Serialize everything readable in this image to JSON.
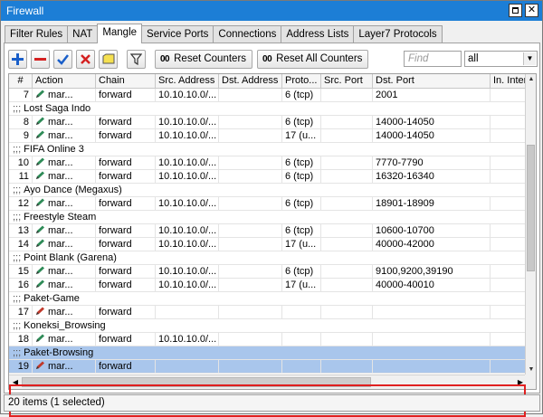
{
  "window": {
    "title": "Firewall"
  },
  "tabs": [
    {
      "label": "Filter Rules",
      "active": false
    },
    {
      "label": "NAT",
      "active": false
    },
    {
      "label": "Mangle",
      "active": true
    },
    {
      "label": "Service Ports",
      "active": false
    },
    {
      "label": "Connections",
      "active": false
    },
    {
      "label": "Address Lists",
      "active": false
    },
    {
      "label": "Layer7 Protocols",
      "active": false
    }
  ],
  "toolbar": {
    "add_icon": "plus-icon",
    "remove_icon": "minus-icon",
    "enable_icon": "check-icon",
    "disable_icon": "x-icon",
    "comment_icon": "note-icon",
    "filter_icon": "funnel-icon",
    "reset_counters_label": "Reset Counters",
    "reset_all_counters_label": "Reset All Counters",
    "counter_icon_text": "00",
    "find_placeholder": "Find",
    "filter_select_value": "all"
  },
  "colors": {
    "titlebar": "#1c7ed6",
    "selected_row": "#a9c6ec",
    "highlight_border": "#e02020",
    "add_icon": "#1a5fc9",
    "remove_icon": "#d42020",
    "pencil_green": "#2e8b57",
    "pencil_red": "#c0392b"
  },
  "table": {
    "columns": [
      "#",
      "Action",
      "Chain",
      "Src. Address",
      "Dst. Address",
      "Proto...",
      "Src. Port",
      "Dst. Port",
      "In. Inter..."
    ],
    "rows": [
      {
        "type": "rule",
        "num": "7",
        "action": "mar...",
        "chain": "forward",
        "src": "10.10.10.0/...",
        "dst": "",
        "proto": "6 (tcp)",
        "sport": "",
        "dport": "2001",
        "pencil": "green"
      },
      {
        "type": "comment",
        "text": "Lost Saga Indo"
      },
      {
        "type": "rule",
        "num": "8",
        "action": "mar...",
        "chain": "forward",
        "src": "10.10.10.0/...",
        "dst": "",
        "proto": "6 (tcp)",
        "sport": "",
        "dport": "14000-14050",
        "pencil": "green"
      },
      {
        "type": "rule",
        "num": "9",
        "action": "mar...",
        "chain": "forward",
        "src": "10.10.10.0/...",
        "dst": "",
        "proto": "17 (u...",
        "sport": "",
        "dport": "14000-14050",
        "pencil": "green"
      },
      {
        "type": "comment",
        "text": "FIFA Online 3"
      },
      {
        "type": "rule",
        "num": "10",
        "action": "mar...",
        "chain": "forward",
        "src": "10.10.10.0/...",
        "dst": "",
        "proto": "6 (tcp)",
        "sport": "",
        "dport": "7770-7790",
        "pencil": "green"
      },
      {
        "type": "rule",
        "num": "11",
        "action": "mar...",
        "chain": "forward",
        "src": "10.10.10.0/...",
        "dst": "",
        "proto": "6 (tcp)",
        "sport": "",
        "dport": "16320-16340",
        "pencil": "green"
      },
      {
        "type": "comment",
        "text": "Ayo Dance (Megaxus)"
      },
      {
        "type": "rule",
        "num": "12",
        "action": "mar...",
        "chain": "forward",
        "src": "10.10.10.0/...",
        "dst": "",
        "proto": "6 (tcp)",
        "sport": "",
        "dport": "18901-18909",
        "pencil": "green"
      },
      {
        "type": "comment",
        "text": "Freestyle Steam"
      },
      {
        "type": "rule",
        "num": "13",
        "action": "mar...",
        "chain": "forward",
        "src": "10.10.10.0/...",
        "dst": "",
        "proto": "6 (tcp)",
        "sport": "",
        "dport": "10600-10700",
        "pencil": "green"
      },
      {
        "type": "rule",
        "num": "14",
        "action": "mar...",
        "chain": "forward",
        "src": "10.10.10.0/...",
        "dst": "",
        "proto": "17 (u...",
        "sport": "",
        "dport": "40000-42000",
        "pencil": "green"
      },
      {
        "type": "comment",
        "text": "Point Blank (Garena)"
      },
      {
        "type": "rule",
        "num": "15",
        "action": "mar...",
        "chain": "forward",
        "src": "10.10.10.0/...",
        "dst": "",
        "proto": "6 (tcp)",
        "sport": "",
        "dport": "9100,9200,39190",
        "pencil": "green"
      },
      {
        "type": "rule",
        "num": "16",
        "action": "mar...",
        "chain": "forward",
        "src": "10.10.10.0/...",
        "dst": "",
        "proto": "17 (u...",
        "sport": "",
        "dport": "40000-40010",
        "pencil": "green"
      },
      {
        "type": "comment",
        "text": "Paket-Game"
      },
      {
        "type": "rule",
        "num": "17",
        "action": "mar...",
        "chain": "forward",
        "src": "",
        "dst": "",
        "proto": "",
        "sport": "",
        "dport": "",
        "pencil": "red"
      },
      {
        "type": "comment",
        "text": "Koneksi_Browsing"
      },
      {
        "type": "rule",
        "num": "18",
        "action": "mar...",
        "chain": "forward",
        "src": "10.10.10.0/...",
        "dst": "",
        "proto": "",
        "sport": "",
        "dport": "",
        "pencil": "green"
      },
      {
        "type": "comment",
        "text": "Paket-Browsing",
        "selected": true
      },
      {
        "type": "rule",
        "num": "19",
        "action": "mar...",
        "chain": "forward",
        "src": "",
        "dst": "",
        "proto": "",
        "sport": "",
        "dport": "",
        "pencil": "red",
        "selected": true
      }
    ]
  },
  "comment_prefix": ";;;",
  "status": {
    "text": "20 items (1 selected)"
  }
}
